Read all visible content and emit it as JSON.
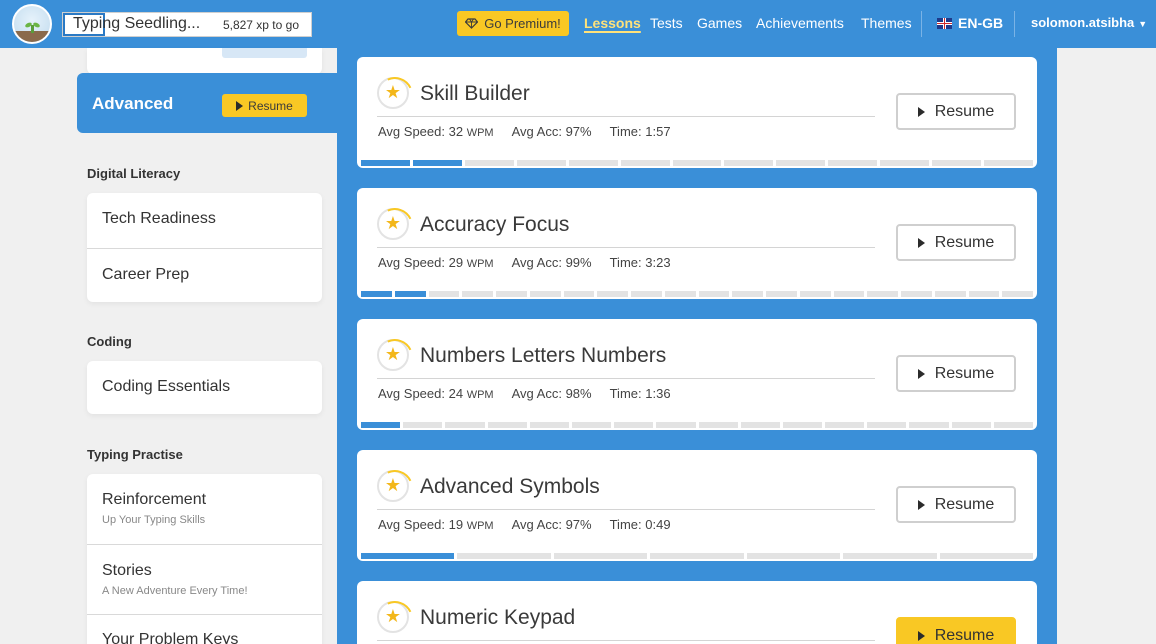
{
  "header": {
    "level_name": "Typing Seedling...",
    "xp_to_go": "5,827 xp to go",
    "level_progress": 0.17,
    "premium_label": "Go Premium!",
    "nav": [
      {
        "label": "Lessons",
        "active": true
      },
      {
        "label": "Tests",
        "active": false
      },
      {
        "label": "Games",
        "active": false
      },
      {
        "label": "Achievements",
        "active": false
      },
      {
        "label": "Themes",
        "active": false
      }
    ],
    "language": "EN-GB",
    "username": "solomon.atsibha"
  },
  "sidebar": {
    "active_course": {
      "title": "Advanced",
      "resume_label": "Resume"
    },
    "sections": [
      {
        "heading": "Digital Literacy",
        "items": [
          {
            "label": "Tech Readiness",
            "sub": ""
          },
          {
            "label": "Career Prep",
            "sub": ""
          }
        ]
      },
      {
        "heading": "Coding",
        "items": [
          {
            "label": "Coding Essentials",
            "sub": ""
          }
        ]
      },
      {
        "heading": "Typing Practise",
        "items": [
          {
            "label": "Reinforcement",
            "sub": "Up Your Typing Skills"
          },
          {
            "label": "Stories",
            "sub": "A New Adventure Every Time!"
          },
          {
            "label": "Your Problem Keys",
            "sub": ""
          }
        ]
      }
    ]
  },
  "lessons": [
    {
      "title": "Skill Builder",
      "speed_label": "Avg Speed:",
      "speed": "32",
      "speed_unit": "WPM",
      "acc_label": "Avg Acc:",
      "acc": "97%",
      "time_label": "Time:",
      "time": "1:57",
      "resume_label": "Resume",
      "segments_total": 13,
      "segments_done": 2,
      "resume_highlight": false
    },
    {
      "title": "Accuracy Focus",
      "speed_label": "Avg Speed:",
      "speed": "29",
      "speed_unit": "WPM",
      "acc_label": "Avg Acc:",
      "acc": "99%",
      "time_label": "Time:",
      "time": "3:23",
      "resume_label": "Resume",
      "segments_total": 20,
      "segments_done": 2,
      "resume_highlight": false
    },
    {
      "title": "Numbers Letters Numbers",
      "speed_label": "Avg Speed:",
      "speed": "24",
      "speed_unit": "WPM",
      "acc_label": "Avg Acc:",
      "acc": "98%",
      "time_label": "Time:",
      "time": "1:36",
      "resume_label": "Resume",
      "segments_total": 16,
      "segments_done": 1,
      "resume_highlight": false
    },
    {
      "title": "Advanced Symbols",
      "speed_label": "Avg Speed:",
      "speed": "19",
      "speed_unit": "WPM",
      "acc_label": "Avg Acc:",
      "acc": "97%",
      "time_label": "Time:",
      "time": "0:49",
      "resume_label": "Resume",
      "segments_total": 7,
      "segments_done": 1,
      "resume_highlight": false
    },
    {
      "title": "Numeric Keypad",
      "speed_label": "",
      "speed": "",
      "speed_unit": "",
      "acc_label": "",
      "acc": "",
      "time_label": "",
      "time": "",
      "resume_label": "Resume",
      "segments_total": 0,
      "segments_done": 0,
      "resume_highlight": true
    }
  ],
  "colors": {
    "brand_blue": "#3a8fd8",
    "premium_yellow": "#f9c824",
    "star_gold": "#f3b71a"
  }
}
